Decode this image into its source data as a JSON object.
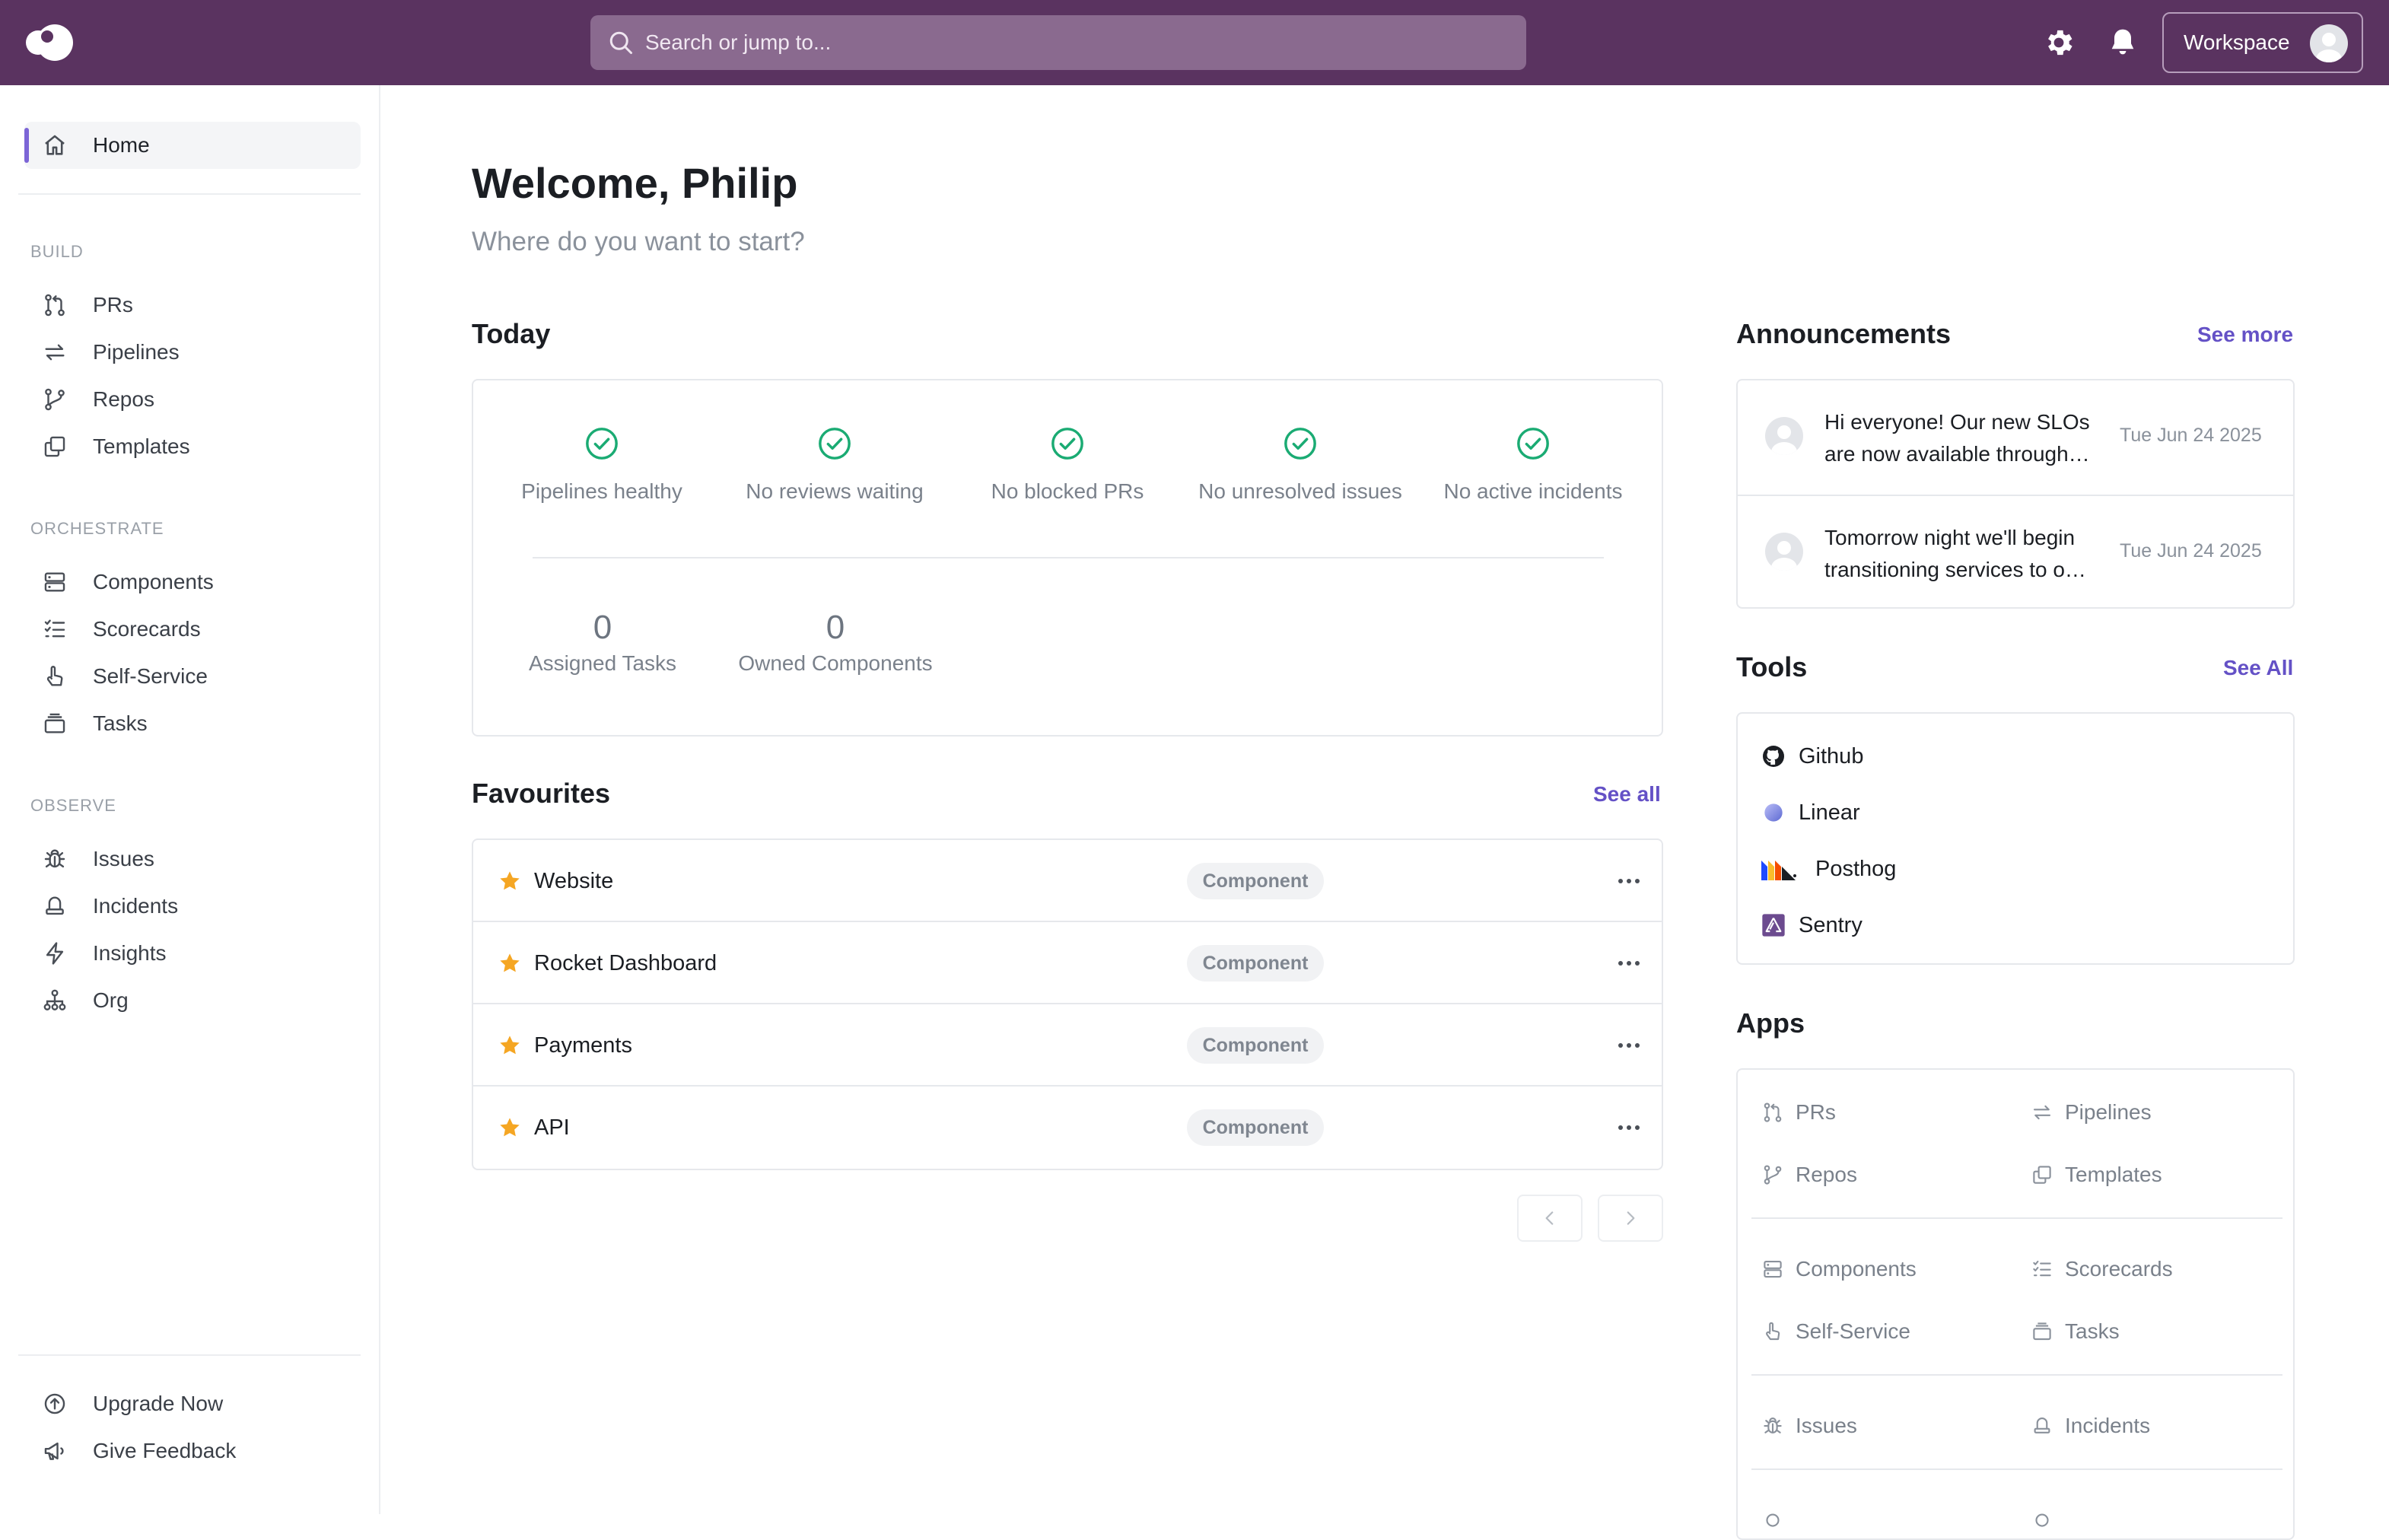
{
  "topbar": {
    "search_placeholder": "Search or jump to...",
    "workspace_label": "Workspace"
  },
  "sidebar": {
    "home": "Home",
    "build_label": "BUILD",
    "build": [
      {
        "label": "PRs",
        "icon": "pull-request-icon"
      },
      {
        "label": "Pipelines",
        "icon": "pipelines-icon"
      },
      {
        "label": "Repos",
        "icon": "branch-icon"
      },
      {
        "label": "Templates",
        "icon": "copy-icon"
      }
    ],
    "orchestrate_label": "ORCHESTRATE",
    "orchestrate": [
      {
        "label": "Components",
        "icon": "server-icon"
      },
      {
        "label": "Scorecards",
        "icon": "checklist-icon"
      },
      {
        "label": "Self-Service",
        "icon": "pointer-hand-icon"
      },
      {
        "label": "Tasks",
        "icon": "tray-stack-icon"
      }
    ],
    "observe_label": "OBSERVE",
    "observe": [
      {
        "label": "Issues",
        "icon": "bug-icon"
      },
      {
        "label": "Incidents",
        "icon": "siren-icon"
      },
      {
        "label": "Insights",
        "icon": "bolt-icon"
      },
      {
        "label": "Org",
        "icon": "org-chart-icon"
      }
    ],
    "footer": [
      {
        "label": "Upgrade Now",
        "icon": "upgrade-arrow-icon"
      },
      {
        "label": "Give Feedback",
        "icon": "megaphone-icon"
      }
    ]
  },
  "main": {
    "title": "Welcome, Philip",
    "subtitle": "Where do you want to start?",
    "today": {
      "heading": "Today",
      "stats": [
        "Pipelines healthy",
        "No reviews waiting",
        "No blocked PRs",
        "No unresolved issues",
        "No active incidents"
      ],
      "counts": [
        {
          "value": "0",
          "label": "Assigned Tasks"
        },
        {
          "value": "0",
          "label": "Owned Components"
        }
      ]
    },
    "favourites": {
      "heading": "Favourites",
      "see_all": "See all",
      "items": [
        {
          "name": "Website",
          "badge": "Component"
        },
        {
          "name": "Rocket Dashboard",
          "badge": "Component"
        },
        {
          "name": "Payments",
          "badge": "Component"
        },
        {
          "name": "API",
          "badge": "Component"
        }
      ]
    }
  },
  "right": {
    "announcements": {
      "heading": "Announcements",
      "see_more": "See more",
      "items": [
        {
          "text": "Hi everyone! Our new SLOs are now available through…",
          "date": "Tue Jun 24 2025"
        },
        {
          "text": "Tomorrow night we'll begin transitioning services to o…",
          "date": "Tue Jun 24 2025"
        }
      ]
    },
    "tools": {
      "heading": "Tools",
      "see_all": "See All",
      "items": [
        "Github",
        "Linear",
        "Posthog",
        "Sentry"
      ]
    },
    "apps": {
      "heading": "Apps",
      "items": [
        "PRs",
        "Pipelines",
        "Repos",
        "Templates",
        "Components",
        "Scorecards",
        "Self-Service",
        "Tasks",
        "Issues",
        "Incidents"
      ]
    }
  },
  "colors": {
    "topbar": "#5a3360",
    "accent": "#6451c6",
    "success": "#1aab73",
    "star": "#f5a623"
  }
}
